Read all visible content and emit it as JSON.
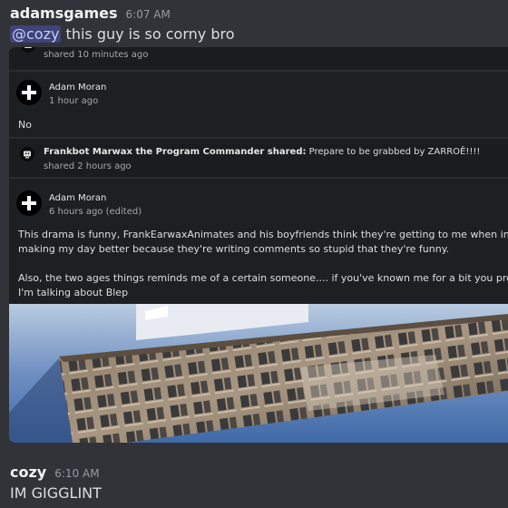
{
  "message1": {
    "username": "adamsgames",
    "timestamp": "6:07 AM",
    "mention": "@cozy",
    "text": " this guy is so corny bro"
  },
  "embed": {
    "top_share_meta": "shared 10 minutes ago",
    "comment1": {
      "author": "Adam Moran",
      "meta": "1 hour ago",
      "text": "No"
    },
    "share2": {
      "author": "Frankbot Marwax the Program Commander shared:",
      "text": " Prepare to be grabbed by ZARROÊ!!!!",
      "meta": "shared 2 hours ago"
    },
    "comment2": {
      "author": "Adam Moran",
      "meta": "6 hours ago (edited)",
      "lines": [
        "This drama is funny, FrankEarwaxAnimates and his boyfriends think they're getting to me when in reality t",
        "making my day better because they're writing comments so stupid that they're funny.",
        "",
        "Also, the two ages things reminds me of a certain someone.... if you've known me for a bit you probably k",
        "I'm talking about Blep"
      ]
    }
  },
  "message2": {
    "username": "cozy",
    "timestamp": "6:10 AM",
    "text": "IM GIGGLINT"
  },
  "icons": {
    "avatar_icon": "plus-cross-icon",
    "bot_icon": "robot-icon"
  },
  "colors": {
    "background": "#313338",
    "embed_bg": "#1e1f22",
    "mention_bg": "#5865f2"
  }
}
